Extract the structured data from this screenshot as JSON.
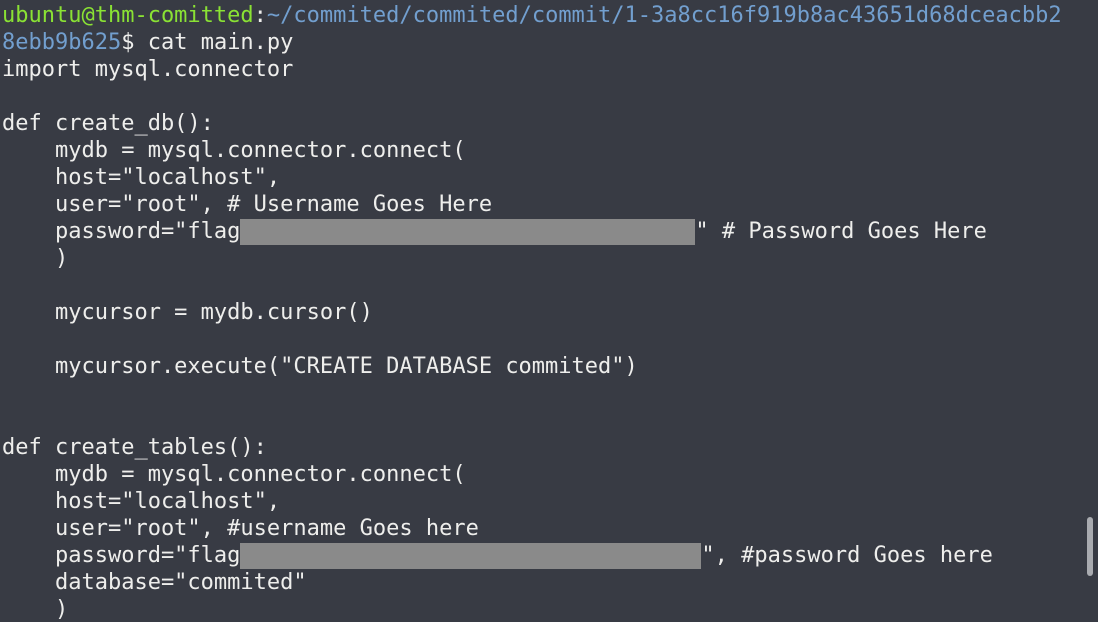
{
  "prompt": {
    "user_host": "ubuntu@thm-comitted",
    "colon": ":",
    "path_part1": "~/commited/commited/commit/1-3a8cc16f919b8ac43651d68dceacbb2",
    "path_part2": "8ebb9b625",
    "dollar": "$ ",
    "command": "cat main.py"
  },
  "code": {
    "l01": "import mysql.connector",
    "l03": "def create_db():",
    "l04": "    mydb = mysql.connector.connect(",
    "l05": "    host=\"localhost\",",
    "l06": "    user=\"root\", # Username Goes Here",
    "l07_pre": "    password=\"flag",
    "l07_post": "\" # Password Goes Here",
    "l08": "    )",
    "l10": "    mycursor = mydb.cursor()",
    "l12": "    mycursor.execute(\"CREATE DATABASE commited\")",
    "l15": "def create_tables():",
    "l16": "    mydb = mysql.connector.connect(",
    "l17": "    host=\"localhost\",",
    "l18": "    user=\"root\", #username Goes here",
    "l19_pre": "    password=\"flag",
    "l19_post": "\", #password Goes here",
    "l20": "    database=\"commited\"",
    "l21": "    )"
  },
  "colors": {
    "background": "#383b44",
    "prompt_user": "#8ae234",
    "prompt_path": "#729fcf",
    "text": "#eeeeec",
    "redaction": "#8a8a8a"
  }
}
